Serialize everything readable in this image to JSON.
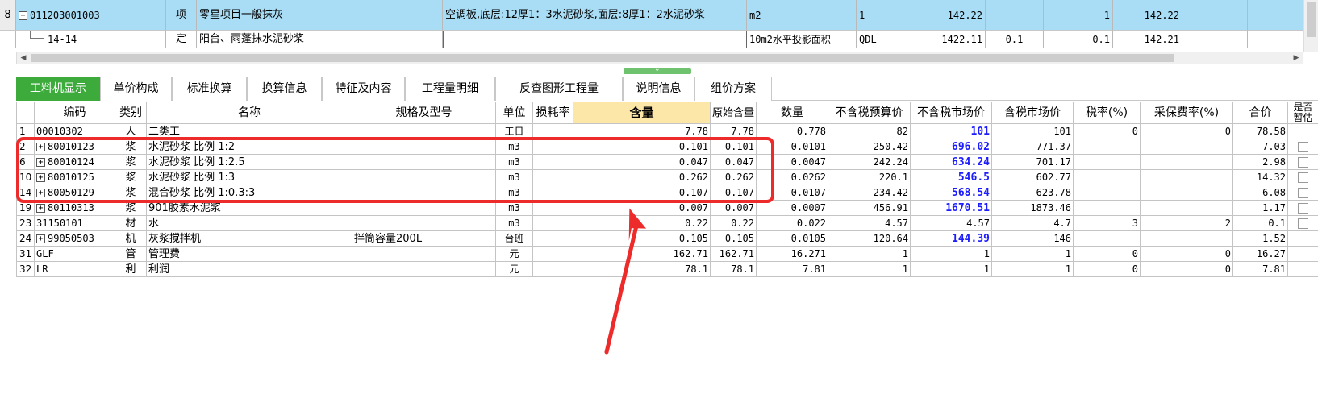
{
  "top_grid": {
    "rows": [
      {
        "row_num": "8",
        "expand": "−",
        "code": "011203001003",
        "type": "项",
        "name": "零星项目一般抹灰",
        "feature": "空调板,底层:12厚1：3水泥砂浆,面层:8厚1：2水泥砂浆",
        "unit": "m2",
        "qty_expr": "1",
        "qty": "142.22",
        "c1": "",
        "c2": "1",
        "c3": "142.22"
      },
      {
        "row_num": "",
        "code": "14-14",
        "type": "定",
        "name": "阳台、雨蓬抹水泥砂浆",
        "feature": "",
        "unit": "10m2水平投影面积",
        "qty_expr": "QDL",
        "qty": "1422.11",
        "c1": "0.1",
        "c2": "0.1",
        "c3": "142.21"
      }
    ]
  },
  "tabs": [
    {
      "label": "工料机显示",
      "active": true
    },
    {
      "label": "单价构成",
      "active": false
    },
    {
      "label": "标准换算",
      "active": false
    },
    {
      "label": "换算信息",
      "active": false
    },
    {
      "label": "特征及内容",
      "active": false
    },
    {
      "label": "工程量明细",
      "active": false
    },
    {
      "label": "反查图形工程量",
      "active": false
    },
    {
      "label": "说明信息",
      "active": false
    },
    {
      "label": "组价方案",
      "active": false
    }
  ],
  "grid": {
    "headers": {
      "code": "编码",
      "type": "类别",
      "name": "名称",
      "spec": "规格及型号",
      "unit": "单位",
      "loss": "损耗率",
      "content": "含量",
      "orig_content": "原始含量",
      "qty": "数量",
      "budget_price": "不含税预算价",
      "market_price": "不含税市场价",
      "tax_market_price": "含税市场价",
      "tax_rate": "税率(%)",
      "purchase_rate": "采保费率(%)",
      "total": "合价",
      "estimate": "是否暂估"
    },
    "rows": [
      {
        "num": "1",
        "expand": false,
        "code": "00010302",
        "type": "人",
        "name": "二类工",
        "spec": "",
        "unit": "工日",
        "loss": "",
        "content": "7.78",
        "orig": "7.78",
        "qty": "0.778",
        "budget": "82",
        "market": "101",
        "market_blue": true,
        "tax_market": "101",
        "tax_rate": "0",
        "purchase": "0",
        "total": "78.58",
        "chk": false
      },
      {
        "num": "2",
        "expand": true,
        "code": "80010123",
        "type": "浆",
        "name": "水泥砂浆 比例 1:2",
        "spec": "",
        "unit": "m3",
        "loss": "",
        "content": "0.101",
        "orig": "0.101",
        "qty": "0.0101",
        "budget": "250.42",
        "market": "696.02",
        "market_blue": true,
        "tax_market": "771.37",
        "tax_rate": "",
        "purchase": "",
        "total": "7.03",
        "chk": true
      },
      {
        "num": "6",
        "expand": true,
        "code": "80010124",
        "type": "浆",
        "name": "水泥砂浆 比例 1:2.5",
        "spec": "",
        "unit": "m3",
        "loss": "",
        "content": "0.047",
        "orig": "0.047",
        "qty": "0.0047",
        "budget": "242.24",
        "market": "634.24",
        "market_blue": true,
        "tax_market": "701.17",
        "tax_rate": "",
        "purchase": "",
        "total": "2.98",
        "chk": true
      },
      {
        "num": "10",
        "expand": true,
        "code": "80010125",
        "type": "浆",
        "name": "水泥砂浆 比例 1:3",
        "spec": "",
        "unit": "m3",
        "loss": "",
        "content": "0.262",
        "orig": "0.262",
        "qty": "0.0262",
        "budget": "220.1",
        "market": "546.5",
        "market_blue": true,
        "tax_market": "602.77",
        "tax_rate": "",
        "purchase": "",
        "total": "14.32",
        "chk": true
      },
      {
        "num": "14",
        "expand": true,
        "code": "80050129",
        "type": "浆",
        "name": "混合砂浆 比例 1:0.3:3",
        "spec": "",
        "unit": "m3",
        "loss": "",
        "content": "0.107",
        "orig": "0.107",
        "qty": "0.0107",
        "budget": "234.42",
        "market": "568.54",
        "market_blue": true,
        "tax_market": "623.78",
        "tax_rate": "",
        "purchase": "",
        "total": "6.08",
        "chk": true
      },
      {
        "num": "19",
        "expand": true,
        "code": "80110313",
        "type": "浆",
        "name": "901胶素水泥浆",
        "spec": "",
        "unit": "m3",
        "loss": "",
        "content": "0.007",
        "orig": "0.007",
        "qty": "0.0007",
        "budget": "456.91",
        "market": "1670.51",
        "market_blue": true,
        "tax_market": "1873.46",
        "tax_rate": "",
        "purchase": "",
        "total": "1.17",
        "chk": true
      },
      {
        "num": "23",
        "expand": false,
        "code": "31150101",
        "type": "材",
        "name": "水",
        "spec": "",
        "unit": "m3",
        "loss": "",
        "content": "0.22",
        "orig": "0.22",
        "qty": "0.022",
        "budget": "4.57",
        "market": "4.57",
        "market_blue": false,
        "tax_market": "4.7",
        "tax_rate": "3",
        "purchase": "2",
        "total": "0.1",
        "chk": true
      },
      {
        "num": "24",
        "expand": true,
        "code": "99050503",
        "type": "机",
        "name": "灰浆搅拌机",
        "spec": "拌筒容量200L",
        "unit": "台班",
        "loss": "",
        "content": "0.105",
        "orig": "0.105",
        "qty": "0.0105",
        "budget": "120.64",
        "market": "144.39",
        "market_blue": true,
        "tax_market": "146",
        "tax_rate": "",
        "purchase": "",
        "total": "1.52",
        "chk": false
      },
      {
        "num": "31",
        "expand": false,
        "code": "GLF",
        "type": "管",
        "name": "管理费",
        "spec": "",
        "unit": "元",
        "loss": "",
        "content": "162.71",
        "orig": "162.71",
        "qty": "16.271",
        "budget": "1",
        "market": "1",
        "market_blue": false,
        "tax_market": "1",
        "tax_rate": "0",
        "purchase": "0",
        "total": "16.27",
        "chk": false
      },
      {
        "num": "32",
        "expand": false,
        "code": "LR",
        "type": "利",
        "name": "利润",
        "spec": "",
        "unit": "元",
        "loss": "",
        "content": "78.1",
        "orig": "78.1",
        "qty": "7.81",
        "budget": "1",
        "market": "1",
        "market_blue": false,
        "tax_market": "1",
        "tax_rate": "0",
        "purchase": "0",
        "total": "7.81",
        "chk": false
      }
    ]
  },
  "colors": {
    "selected_row": "#a9ddf6",
    "active_tab": "#3cab3c",
    "selected_header": "#fde7a8",
    "price_blue": "#1c1cff",
    "annotation_red": "#ee2b2b"
  }
}
